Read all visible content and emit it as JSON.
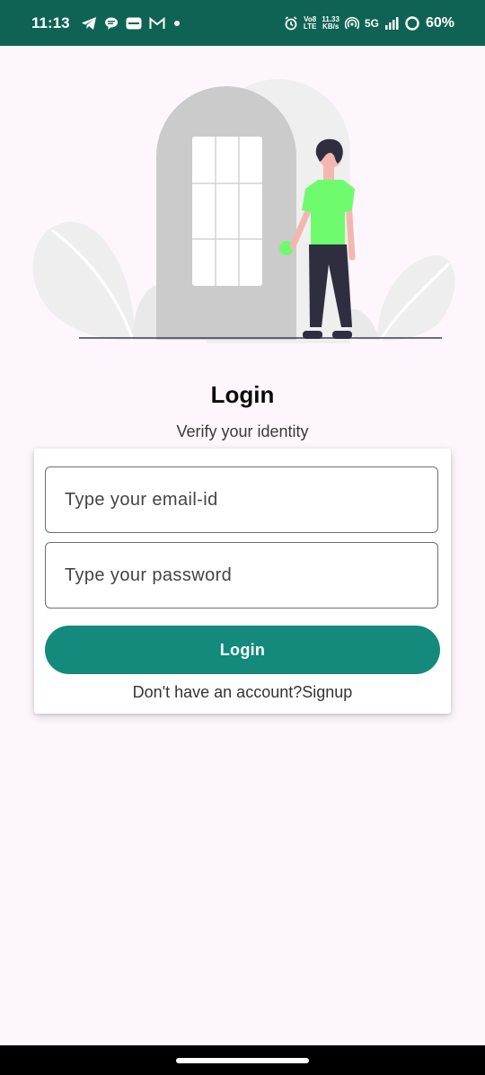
{
  "status_bar": {
    "time": "11:13",
    "volte_top": "Vo8",
    "volte_bottom": "LTE",
    "speed_value": "11.33",
    "speed_unit": "KB/s",
    "network": "5G",
    "battery": "60%",
    "bg_color": "#0f6355"
  },
  "illustration": {
    "icon": "person-at-door-illustration",
    "shirt_color": "#6efc6e"
  },
  "login": {
    "title": "Login",
    "subtitle": "Verify your identity",
    "email_placeholder": "Type your email-id",
    "email_value": "",
    "password_placeholder": "Type your password",
    "password_value": "",
    "button_label": "Login",
    "signup_prompt": "Don't have an account?",
    "signup_link": "Signup",
    "accent_color": "#138a7b"
  }
}
